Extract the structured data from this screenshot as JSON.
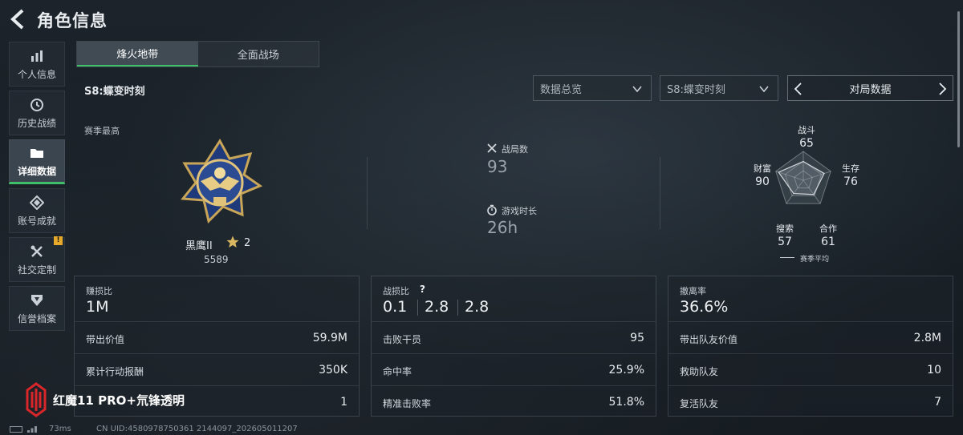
{
  "header": {
    "title": "角色信息",
    "back_icon": "back-arrow-icon"
  },
  "sidebar": {
    "items": [
      {
        "label": "个人信息",
        "icon": "bar-chart-icon",
        "active": false
      },
      {
        "label": "历史战绩",
        "icon": "clock-icon",
        "active": false
      },
      {
        "label": "详细数据",
        "icon": "folder-icon",
        "active": true
      },
      {
        "label": "账号成就",
        "icon": "diamond-icon",
        "active": false
      },
      {
        "label": "社交定制",
        "icon": "tools-icon",
        "active": false,
        "badge": "!"
      },
      {
        "label": "信誉档案",
        "icon": "shield-icon",
        "active": false
      }
    ]
  },
  "tabs": [
    {
      "label": "烽火地带",
      "active": true
    },
    {
      "label": "全面战场",
      "active": false
    }
  ],
  "season_title": "S8:蝶变时刻",
  "filters": {
    "data_view": "数据总览",
    "season": "S8:蝶变时刻",
    "pager_label": "对局数据"
  },
  "summary": {
    "season_best_label": "赛季最高",
    "rank_name": "黑鹰II",
    "rank_level": "2",
    "rank_score": "5589",
    "matches_label": "战局数",
    "matches_value": "93",
    "playtime_label": "游戏时长",
    "playtime_value": "26h"
  },
  "radar": {
    "axes": [
      {
        "label": "战斗",
        "value": 65
      },
      {
        "label": "生存",
        "value": 76
      },
      {
        "label": "合作",
        "value": 61
      },
      {
        "label": "搜索",
        "value": 57
      },
      {
        "label": "财富",
        "value": 90
      }
    ],
    "legend": "赛季平均"
  },
  "cards": {
    "profit": {
      "label": "赚损比",
      "value": "1M",
      "rows": [
        {
          "k": "带出价值",
          "v": "59.9M"
        },
        {
          "k": "累计行动报酬",
          "v": "350K"
        },
        {
          "k": "",
          "v": "1"
        }
      ]
    },
    "kd": {
      "label": "战损比",
      "help": "?",
      "values": [
        "0.1",
        "2.8",
        "2.8"
      ],
      "rows": [
        {
          "k": "击败干员",
          "v": "95"
        },
        {
          "k": "命中率",
          "v": "25.9%"
        },
        {
          "k": "精准击败率",
          "v": "51.8%"
        }
      ]
    },
    "extract": {
      "label": "撤离率",
      "value": "36.6%",
      "rows": [
        {
          "k": "带出队友价值",
          "v": "2.8M"
        },
        {
          "k": "救助队友",
          "v": "10"
        },
        {
          "k": "复活队友",
          "v": "7"
        }
      ]
    }
  },
  "watermark": {
    "text": "红魔11 PRO+氘锋透明"
  },
  "status": {
    "ping": "73ms",
    "uid": "CN UID:4580978750361 2144097_202605011207"
  },
  "colors": {
    "accent": "#3fbf6a",
    "badge": "#e6a92a",
    "bg": "#182026",
    "watermark_red": "#d8262a"
  }
}
